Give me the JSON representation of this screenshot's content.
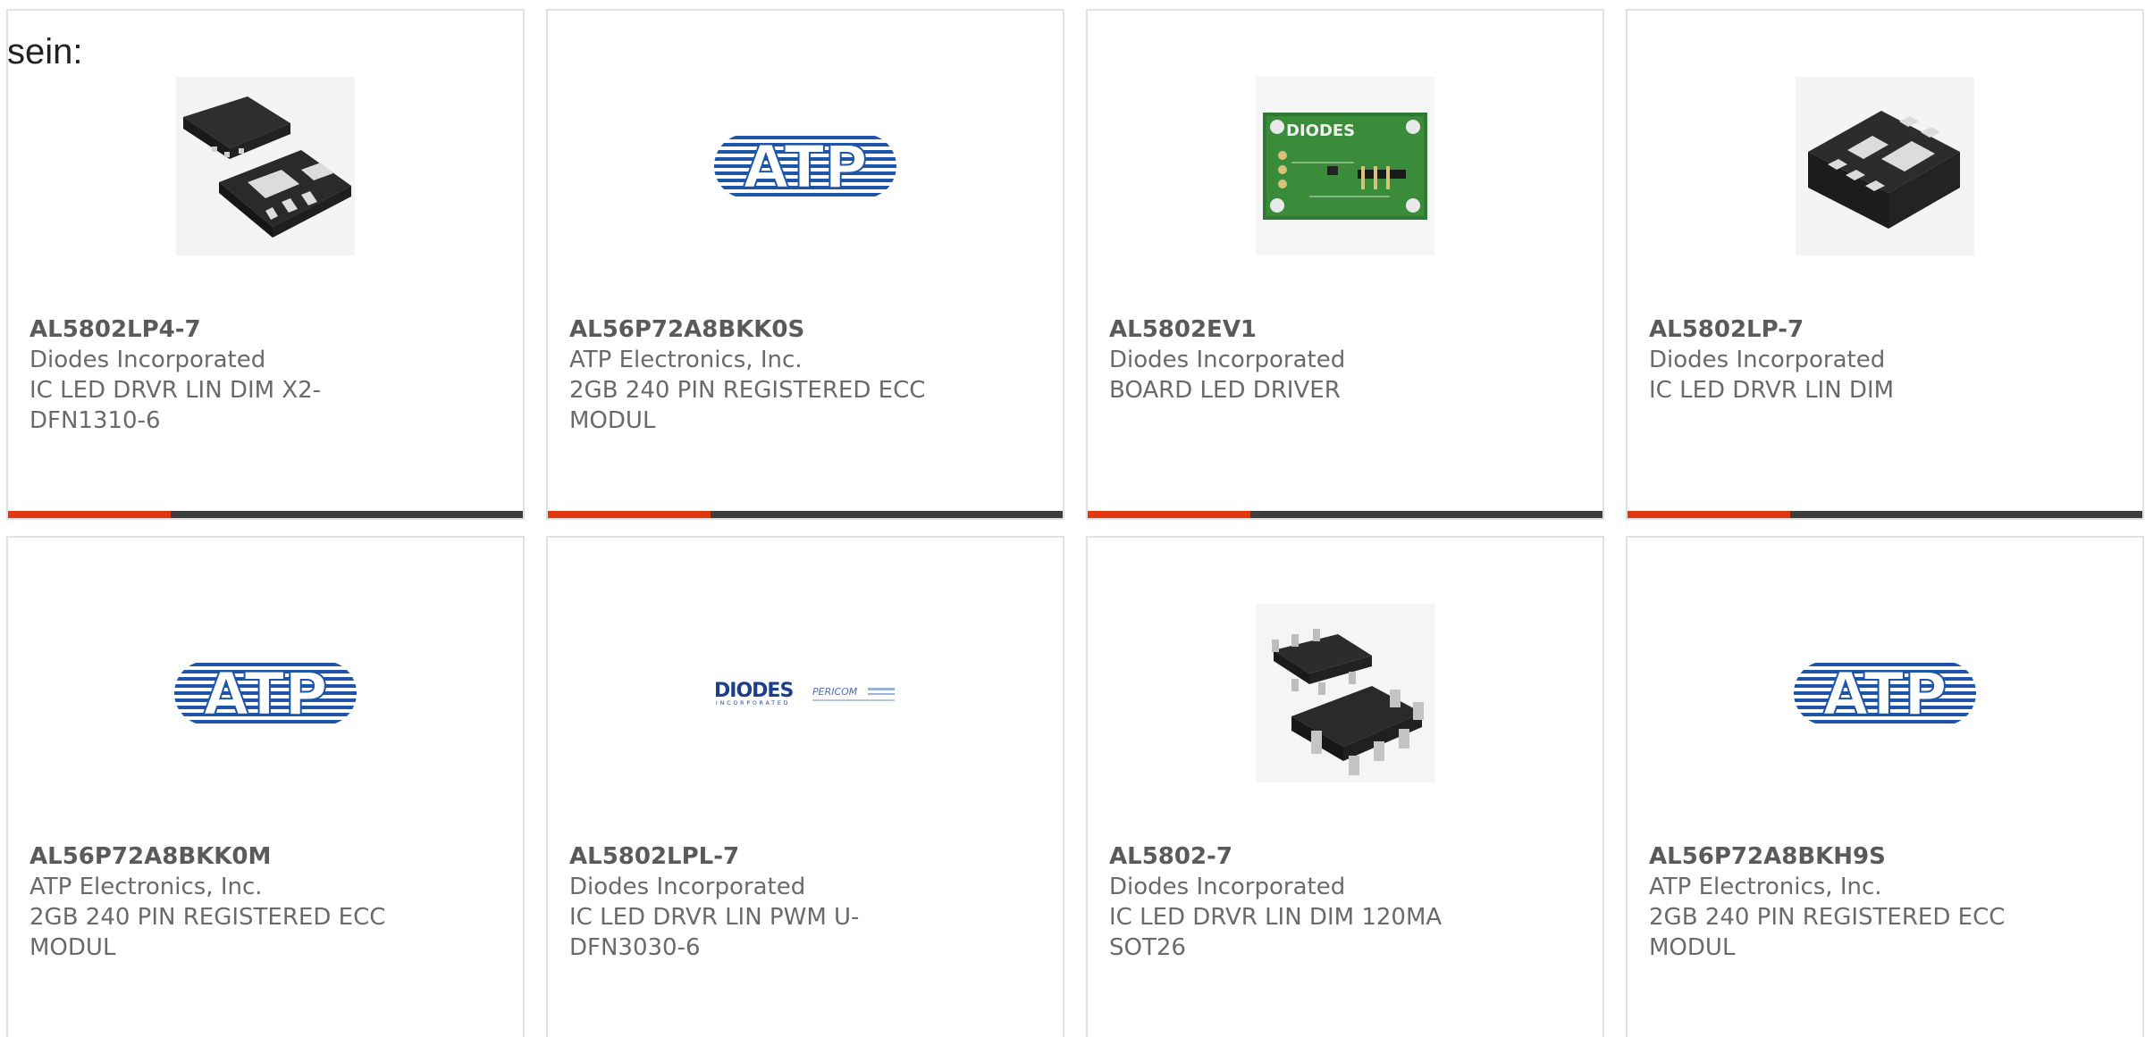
{
  "intro_text": "sein:",
  "products": [
    {
      "part": "AL5802LP4-7",
      "manufacturer": "Diodes Incorporated",
      "description": "IC LED DRVR LIN DIM X2-DFN1310-6",
      "image": "chip-package-icon"
    },
    {
      "part": "AL56P72A8BKK0S",
      "manufacturer": "ATP Electronics, Inc.",
      "description": "2GB 240 PIN REGISTERED ECC MODUL",
      "image": "atp-logo"
    },
    {
      "part": "AL5802EV1",
      "manufacturer": "Diodes Incorporated",
      "description": "BOARD LED DRIVER",
      "image": "eval-board-icon"
    },
    {
      "part": "AL5802LP-7",
      "manufacturer": "Diodes Incorporated",
      "description": "IC LED DRVR LIN DIM",
      "image": "chip-dfn-icon"
    },
    {
      "part": "AL56P72A8BKK0M",
      "manufacturer": "ATP Electronics, Inc.",
      "description": "2GB 240 PIN REGISTERED ECC MODUL",
      "image": "atp-logo"
    },
    {
      "part": "AL5802LPL-7",
      "manufacturer": "Diodes Incorporated",
      "description": "IC LED DRVR LIN PWM U-DFN3030-6",
      "image": "diodes-pericom-logo"
    },
    {
      "part": "AL5802-7",
      "manufacturer": "Diodes Incorporated",
      "description": "IC LED DRVR LIN DIM 120MA SOT26",
      "image": "sot26-chip-icon"
    },
    {
      "part": "AL56P72A8BKH9S",
      "manufacturer": "ATP Electronics, Inc.",
      "description": "2GB 240 PIN REGISTERED ECC MODUL",
      "image": "atp-logo"
    }
  ],
  "logos": {
    "atp": "ATP",
    "diodes": "DIODES",
    "diodes_sub": "INCORPORATED",
    "pericom": "PERICOM"
  },
  "colors": {
    "accent": "#e3380e",
    "bar": "#3d3d3d",
    "atp_blue": "#1f55a8"
  }
}
